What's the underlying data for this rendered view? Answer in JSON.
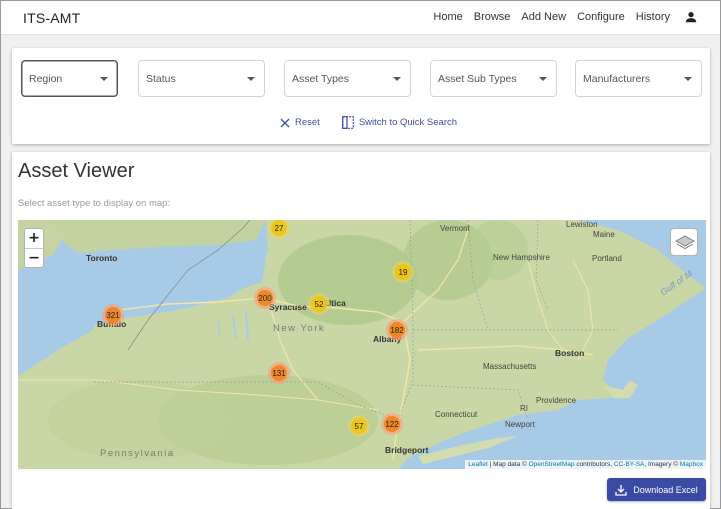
{
  "app": {
    "title": "ITS-AMT"
  },
  "nav": {
    "items": [
      {
        "label": "Home"
      },
      {
        "label": "Browse"
      },
      {
        "label": "Add New"
      },
      {
        "label": "Configure"
      },
      {
        "label": "History"
      }
    ],
    "user_icon": "account-icon"
  },
  "filters": {
    "selects": [
      {
        "label": "Region"
      },
      {
        "label": "Status"
      },
      {
        "label": "Asset Types"
      },
      {
        "label": "Asset Sub Types"
      },
      {
        "label": "Manufacturers"
      }
    ],
    "reset_label": "Reset",
    "switch_label": "Switch to Quick Search",
    "accent_color": "#3b4ea8"
  },
  "viewer": {
    "title": "Asset Viewer",
    "subtitle": "Select asset type to display on map:",
    "download_label": "Download Excel"
  },
  "map": {
    "zoom_in": "+",
    "zoom_out": "−",
    "clusters": [
      {
        "count": "27",
        "color": "yellow"
      },
      {
        "count": "19",
        "color": "yellow"
      },
      {
        "count": "200",
        "color": "orange"
      },
      {
        "count": "52",
        "color": "yellow"
      },
      {
        "count": "321",
        "color": "orange"
      },
      {
        "count": "182",
        "color": "orange"
      },
      {
        "count": "131",
        "color": "orange"
      },
      {
        "count": "122",
        "color": "orange"
      },
      {
        "count": "57",
        "color": "yellow"
      }
    ],
    "labels": {
      "toronto": "Toronto",
      "buffalo": "Buffalo",
      "syracuse": "Syracuse",
      "utica": "Utica",
      "albany": "Albany",
      "new_york": "New York",
      "vermont": "Vermont",
      "new_hampshire": "New Hampshire",
      "maine": "Maine",
      "lewiston": "Lewiston",
      "portland": "Portland",
      "boston": "Boston",
      "massachusetts": "Massachusetts",
      "providence": "Providence",
      "connecticut": "Connecticut",
      "newport": "Newport",
      "bridgeport": "Bridgeport",
      "ri": "RI",
      "pennsylvania": "Pennsylvania",
      "gulf_of_maine": "Gulf of M"
    },
    "attribution": {
      "leaflet": "Leaflet",
      "sep1": " | Map data © ",
      "osm": "OpenStreetMap",
      "sep2": " contributors, ",
      "license": "CC-BY-SA",
      "sep3": ", Imagery © ",
      "mapbox": "Mapbox"
    }
  }
}
